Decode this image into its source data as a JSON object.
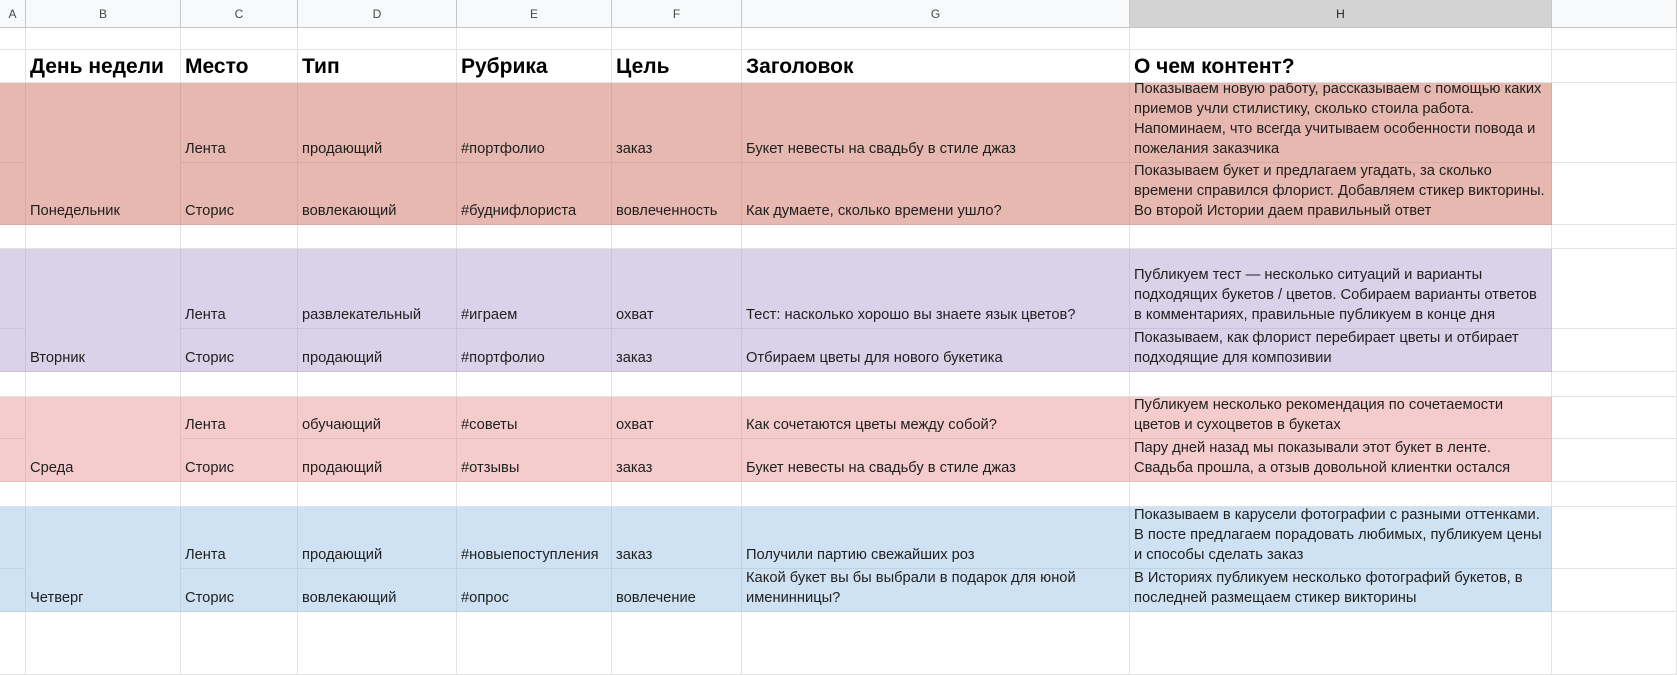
{
  "sheet": {
    "columns": [
      "A",
      "B",
      "C",
      "D",
      "E",
      "F",
      "G",
      "H"
    ],
    "selected_column": "H",
    "headers": [
      "День недели",
      "Место",
      "Тип",
      "Рубрика",
      "Цель",
      "Заголовок",
      "О чем контент?"
    ],
    "days": [
      {
        "day": "Понедельник",
        "color": "#e6b8af",
        "rows": [
          {
            "place": "Лента",
            "type": "продающий",
            "rubric": "#портфолио",
            "goal": "заказ",
            "title": "Букет невесты на свадьбу в стиле джаз",
            "content": "Показываем новую работу, рассказываем с помощью каких приемов учли стилистику, сколько стоила работа. Напоминаем, что всегда учитываем особенности повода и пожелания заказчика"
          },
          {
            "place": "Сторис",
            "type": "вовлекающий",
            "rubric": "#буднифлориста",
            "goal": "вовлеченность",
            "title": "Как думаете, сколько времени ушло?",
            "content": "Показываем букет и предлагаем угадать, за сколько времени справился флорист. Добавляем стикер викторины. Во второй Истории даем правильный ответ"
          }
        ]
      },
      {
        "day": "Вторник",
        "color": "#d9d2e9",
        "rows": [
          {
            "place": "Лента",
            "type": "развлекательный",
            "rubric": "#играем",
            "goal": "охват",
            "title": "Тест: насколько хорошо вы знаете язык цветов?",
            "content": "Публикуем тест — несколько ситуаций и варианты подходящих букетов / цветов. Собираем варианты ответов в комментариях, правильные публикуем в конце дня"
          },
          {
            "place": "Сторис",
            "type": "продающий",
            "rubric": "#портфолио",
            "goal": "заказ",
            "title": "Отбираем цветы для нового букетика",
            "content": "Показываем, как флорист перебирает цветы и отбирает подходящие для композивии"
          }
        ]
      },
      {
        "day": "Среда",
        "color": "#f4cccc",
        "rows": [
          {
            "place": "Лента",
            "type": "обучающий",
            "rubric": "#советы",
            "goal": "охват",
            "title": "Как сочетаются цветы между собой?",
            "content": "Публикуем несколько рекомендация по сочетаемости цветов и сухоцветов в букетах"
          },
          {
            "place": "Сторис",
            "type": "продающий",
            "rubric": "#отзывы",
            "goal": "заказ",
            "title": "Букет невесты на свадьбу в стиле джаз",
            "content": "Пару дней назад мы показывали этот букет в ленте. Свадьба прошла, а отзыв довольной клиентки остался"
          }
        ]
      },
      {
        "day": "Четверг",
        "color": "#cfe2f3",
        "rows": [
          {
            "place": "Лента",
            "type": "продающий",
            "rubric": "#новыепоступления",
            "goal": "заказ",
            "title": "Получили партию свежайших роз",
            "content": "Показываем в карусели фотографии с разными оттенками. В посте предлагаем порадовать любимых, публикуем цены и способы сделать заказ"
          },
          {
            "place": "Сторис",
            "type": "вовлекающий",
            "rubric": "#опрос",
            "goal": "вовлечение",
            "title": "Какой букет вы бы выбрали в подарок для юной именинницы?",
            "content": "В Историях публикуем несколько фотографий букетов, в последней размещаем стикер викторины"
          }
        ]
      }
    ]
  }
}
